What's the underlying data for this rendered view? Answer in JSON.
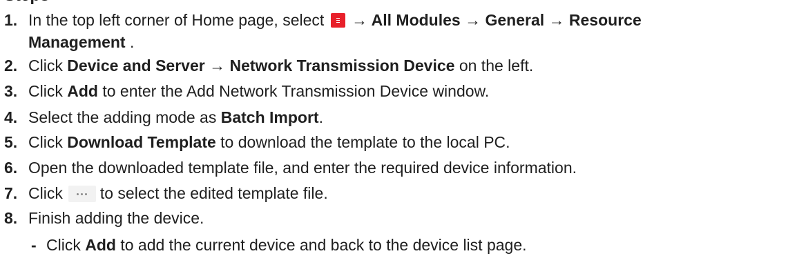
{
  "heading_cut": "Steps",
  "steps": [
    {
      "num": "1.",
      "t1": "In the top left corner of Home page, select ",
      "icon": "menu-icon",
      "t2": " → ",
      "b1": "All Modules",
      "t3": " → ",
      "b2": "General",
      "t4": " → ",
      "b3": "Resource",
      "b4": "Management",
      "t5": " ."
    },
    {
      "num": "2.",
      "t1": "Click ",
      "b1": "Device and Server",
      "t2": " → ",
      "b2": "Network Transmission Device",
      "t3": " on the left."
    },
    {
      "num": "3.",
      "t1": "Click ",
      "b1": "Add",
      "t2": " to enter the Add Network Transmission Device window."
    },
    {
      "num": "4.",
      "t1": "Select the adding mode as ",
      "b1": "Batch Import",
      "t2": "."
    },
    {
      "num": "5.",
      "t1": "Click ",
      "b1": "Download Template",
      "t2": " to download the template to the local PC."
    },
    {
      "num": "6.",
      "t1": "Open the downloaded template file, and enter the required device information."
    },
    {
      "num": "7.",
      "t1": "Click",
      "icon": "ellipsis-icon",
      "t2": "to select the edited template file."
    },
    {
      "num": "8.",
      "t1": "Finish adding the device."
    }
  ],
  "substep": {
    "bullet": "-",
    "t1": "Click ",
    "b1": "Add",
    "t2": " to add the current device and back to the device list page."
  }
}
